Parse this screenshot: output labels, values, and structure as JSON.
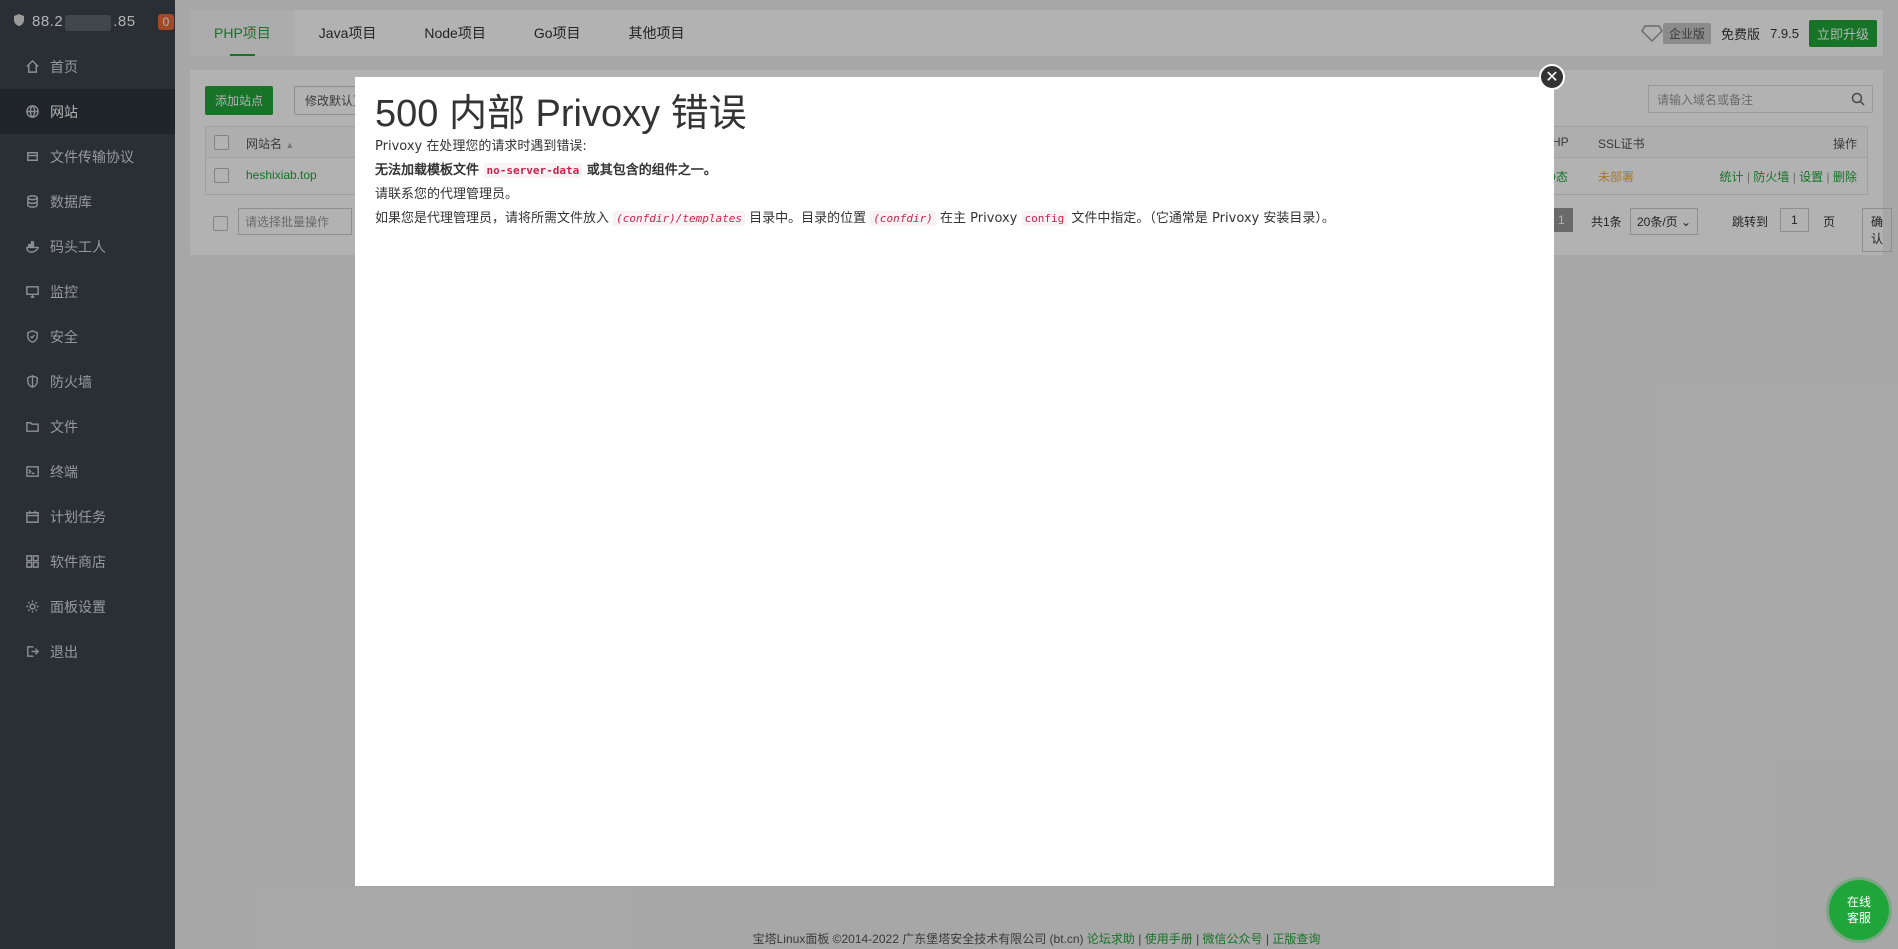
{
  "sidebar": {
    "ip_prefix": "88.2",
    "ip_suffix": ".85",
    "badge": "0",
    "items": [
      {
        "label": "首页",
        "icon": "home-icon"
      },
      {
        "label": "网站",
        "icon": "globe-icon",
        "active": true
      },
      {
        "label": "文件传输协议",
        "icon": "ftp-icon"
      },
      {
        "label": "数据库",
        "icon": "database-icon"
      },
      {
        "label": "码头工人",
        "icon": "docker-icon"
      },
      {
        "label": "监控",
        "icon": "monitor-icon"
      },
      {
        "label": "安全",
        "icon": "shield-icon"
      },
      {
        "label": "防火墙",
        "icon": "firewall-icon"
      },
      {
        "label": "文件",
        "icon": "folder-icon"
      },
      {
        "label": "终端",
        "icon": "terminal-icon"
      },
      {
        "label": "计划任务",
        "icon": "calendar-icon"
      },
      {
        "label": "软件商店",
        "icon": "apps-icon"
      },
      {
        "label": "面板设置",
        "icon": "gear-icon"
      },
      {
        "label": "退出",
        "icon": "logout-icon"
      }
    ]
  },
  "topbar": {
    "tabs": [
      "PHP项目",
      "Java项目",
      "Node项目",
      "Go项目",
      "其他项目"
    ],
    "enterprise": "企业版",
    "free": "免费版",
    "version": "7.9.5",
    "upgrade": "立即升级"
  },
  "panel": {
    "add_site": "添加站点",
    "modify_default": "修改默认页",
    "search_placeholder": "请输入域名或备注",
    "col_site": "网站名",
    "col_php": "PHP",
    "col_ssl": "SSL证书",
    "col_ops": "操作",
    "site_name": "heshixiab.top",
    "php_value": "静态",
    "ssl_value": "未部署",
    "ops": [
      "统计",
      "防火墙",
      "设置",
      "删除"
    ],
    "batch_placeholder": "请选择批量操作",
    "page_current": "1",
    "total": "共1条",
    "per_page": "20条/页",
    "jump_label": "跳转到",
    "jump_value": "1",
    "page_unit": "页",
    "confirm": "确认"
  },
  "modal": {
    "title": "500 内部 Privoxy 错误",
    "line1": "Privoxy 在处理您的请求时遇到错误:",
    "line2_a": "无法加载模板文件",
    "line2_code": "no-server-data",
    "line2_b": "或其包含的组件之一。",
    "line3": "请联系您的代理管理员。",
    "line4_a": "如果您是代理管理员，请将所需文件放入",
    "line4_code1": "(confdir)/templates",
    "line4_b": "目录中。目录的位置",
    "line4_code2": "(confdir)",
    "line4_c": "在主 Privoxy",
    "line4_code3": "config",
    "line4_d": "文件中指定。（它通常是 Privoxy 安装目录）。"
  },
  "footer": {
    "copyright": "宝塔Linux面板 ©2014-2022 广东堡塔安全技术有限公司 (bt.cn)",
    "links": [
      "论坛求助",
      "使用手册",
      "微信公众号",
      "正版查询"
    ]
  },
  "chat": {
    "line1": "在线",
    "line2": "客服"
  }
}
